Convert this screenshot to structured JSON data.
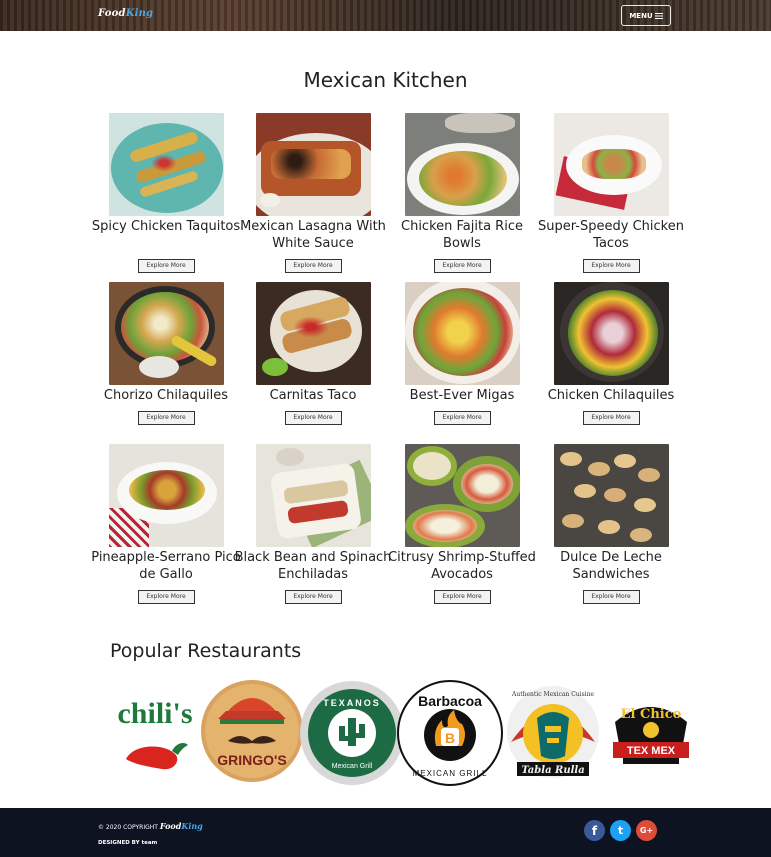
{
  "header": {
    "logo_part1": "Food",
    "logo_part2": "King",
    "menu_label": "MENU"
  },
  "section_title": "Mexican Kitchen",
  "explore_label": "Explore More",
  "recipes": [
    {
      "name": "Spicy Chicken Taquitos"
    },
    {
      "name": "Mexican Lasagna With White Sauce"
    },
    {
      "name": "Chicken Fajita Rice Bowls"
    },
    {
      "name": "Super-Speedy Chicken Tacos"
    },
    {
      "name": "Chorizo Chilaquiles"
    },
    {
      "name": "Carnitas Taco"
    },
    {
      "name": "Best-Ever Migas"
    },
    {
      "name": "Chicken Chilaquiles"
    },
    {
      "name": "Pineapple-Serrano Pico de Gallo"
    },
    {
      "name": "Black Bean and Spinach Enchiladas"
    },
    {
      "name": "Citrusy Shrimp-Stuffed Avocados"
    },
    {
      "name": "Dulce De Leche Sandwiches"
    }
  ],
  "popular_title": "Popular Restaurants",
  "restaurants": {
    "chilis": "chili's",
    "gringos": "GRINGO'S",
    "tavanos_top": "TEXANOS",
    "tavanos_bottom": "Mexican Grill",
    "barbacoa_top": "Barbacoa",
    "barbacoa_letter": "B",
    "barbacoa_bottom": "MEXICAN GRILL",
    "tabla_top": "Authentic Mexican Cuisine",
    "tabla_bottom": "Tabla Rulla",
    "elchico_top": "El Chico",
    "elchico_bottom": "TEX MEX"
  },
  "footer": {
    "copyright": "© 2020 COPYRIGHT",
    "brand1": "Food",
    "brand2": "King",
    "designed": "DESIGNED BY team"
  },
  "social": [
    {
      "icon": "facebook-icon",
      "glyph": "f",
      "color": "#3b5998"
    },
    {
      "icon": "twitter-icon",
      "glyph": "t",
      "color": "#1da1f2"
    },
    {
      "icon": "google-plus-icon",
      "glyph": "G+",
      "color": "#dd4b39"
    }
  ]
}
